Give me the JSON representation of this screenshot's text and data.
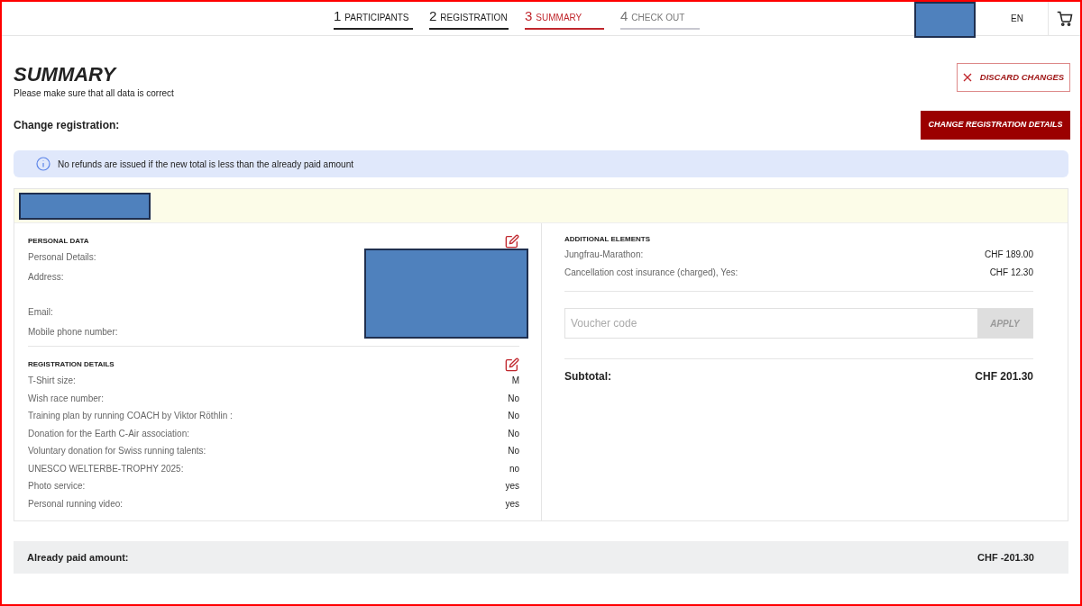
{
  "steps": [
    {
      "number": "1",
      "label": "PARTICIPANTS",
      "kind": "done"
    },
    {
      "number": "2",
      "label": "REGISTRATION",
      "kind": "done"
    },
    {
      "number": "3",
      "label": "SUMMARY",
      "kind": "current"
    },
    {
      "number": "4",
      "label": "CHECK OUT",
      "kind": "upcoming"
    }
  ],
  "language": "EN",
  "title": "SUMMARY",
  "subtitle": "Please make sure that all data is correct",
  "discard_button": "DISCARD CHANGES",
  "change_heading": "Change registration:",
  "change_button": "CHANGE REGISTRATION DETAILS",
  "info_notice": "No refunds are issued if the new total is less than the already paid amount",
  "personal_data": {
    "heading": "PERSONAL DATA",
    "rows": [
      {
        "label": "Personal Details:",
        "kind": "line"
      },
      {
        "label": "Address:",
        "kind": "multiline"
      },
      {
        "label": "Email:",
        "kind": "line"
      },
      {
        "label": "Mobile phone number:",
        "kind": "line"
      }
    ]
  },
  "registration_details": {
    "heading": "REGISTRATION DETAILS",
    "rows": [
      {
        "label": "T-Shirt size:",
        "value": "M"
      },
      {
        "label": "Wish race number:",
        "value": "No"
      },
      {
        "label": "Training plan by running COACH by Viktor Röthlin :",
        "value": "No"
      },
      {
        "label": "Donation for the Earth C-Air association:",
        "value": "No"
      },
      {
        "label": "Voluntary donation for Swiss running talents:",
        "value": "No"
      },
      {
        "label": "UNESCO WELTERBE-TROPHY 2025:",
        "value": "no"
      },
      {
        "label": "Photo service:",
        "value": "yes"
      },
      {
        "label": "Personal running video:",
        "value": "yes"
      }
    ]
  },
  "additional_elements": {
    "heading": "ADDITIONAL ELEMENTS",
    "rows": [
      {
        "label": "Jungfrau-Marathon:",
        "value": "CHF 189.00"
      },
      {
        "label": "Cancellation cost insurance (charged), Yes:",
        "value": "CHF 12.30"
      }
    ]
  },
  "voucher": {
    "placeholder": "Voucher code",
    "button": "APPLY",
    "disabled": true
  },
  "subtotal": {
    "label": "Subtotal:",
    "value": "CHF 201.30"
  },
  "already_paid": {
    "label": "Already paid amount:",
    "value": "CHF -201.30"
  }
}
